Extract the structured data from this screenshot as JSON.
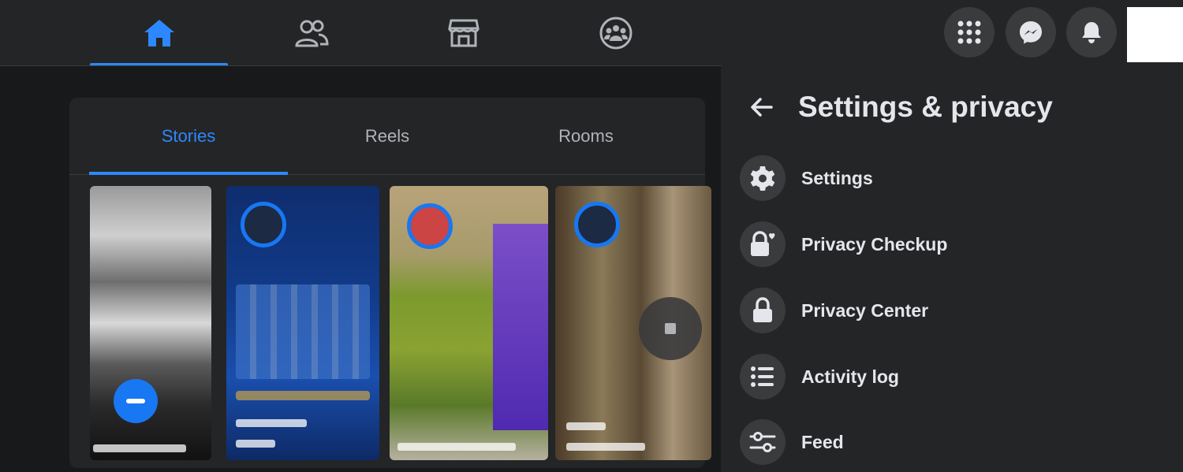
{
  "nav": {
    "tabs": [
      {
        "icon": "home-icon",
        "active": true
      },
      {
        "icon": "friends-icon",
        "active": false
      },
      {
        "icon": "marketplace-icon",
        "active": false
      },
      {
        "icon": "groups-icon",
        "active": false
      }
    ],
    "right_buttons": [
      "menu-grid-icon",
      "messenger-icon",
      "notifications-icon"
    ]
  },
  "stories": {
    "tabs": [
      {
        "label": "Stories",
        "active": true
      },
      {
        "label": "Reels",
        "active": false
      },
      {
        "label": "Rooms",
        "active": false
      }
    ]
  },
  "settings_panel": {
    "title": "Settings & privacy",
    "items": [
      {
        "label": "Settings",
        "icon": "gear-icon"
      },
      {
        "label": "Privacy Checkup",
        "icon": "lock-heart-icon"
      },
      {
        "label": "Privacy Center",
        "icon": "lock-icon"
      },
      {
        "label": "Activity log",
        "icon": "list-icon"
      },
      {
        "label": "Feed",
        "icon": "sliders-icon"
      }
    ]
  },
  "colors": {
    "accent": "#2d88ff",
    "background": "#18191a",
    "surface": "#242526",
    "button": "#3a3b3c",
    "text": "#e4e6eb"
  }
}
